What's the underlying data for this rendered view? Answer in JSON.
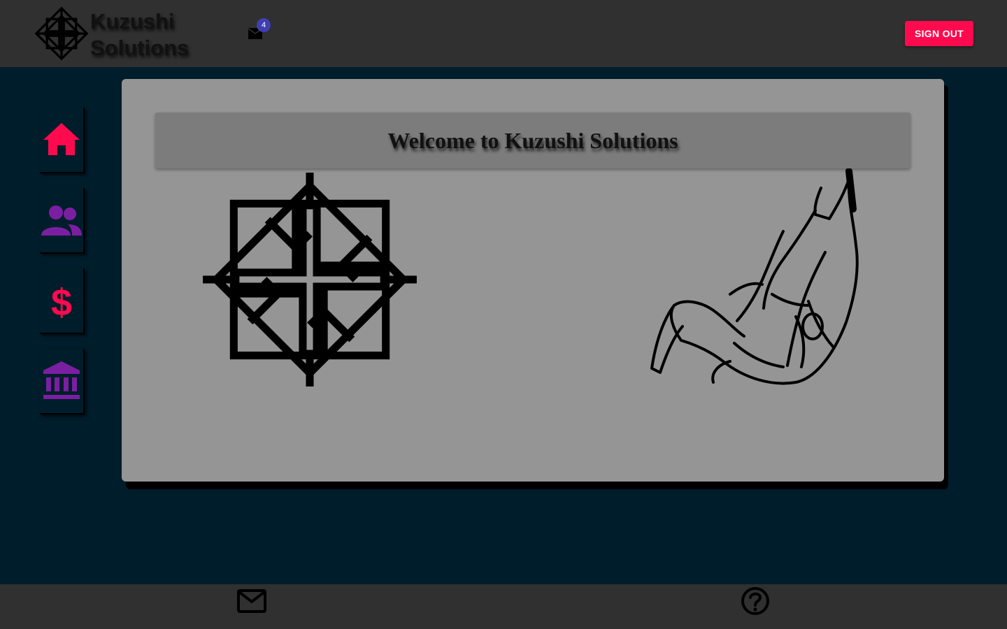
{
  "header": {
    "brand_line1": "Kuzushi",
    "brand_line2": "Solutions",
    "mail_badge_count": "4",
    "signout_label": "SIGN OUT"
  },
  "sidebar": {
    "items": [
      {
        "icon": "home-icon",
        "color": "#ff0a4e"
      },
      {
        "icon": "people-icon",
        "color": "#7b1fa2"
      },
      {
        "icon": "dollar-icon",
        "color": "#ff0a4e"
      },
      {
        "icon": "bank-icon",
        "color": "#7b1fa2"
      }
    ]
  },
  "main": {
    "welcome_title": "Welcome to Kuzushi Solutions"
  },
  "footer": {
    "icons": [
      "mail-icon",
      "help-icon"
    ]
  },
  "colors": {
    "background": "#001d2b",
    "bars": "#303030",
    "accent": "#ff0a4e",
    "purple": "#7b1fa2",
    "badge": "#3f3fb3",
    "card": "#959595"
  }
}
